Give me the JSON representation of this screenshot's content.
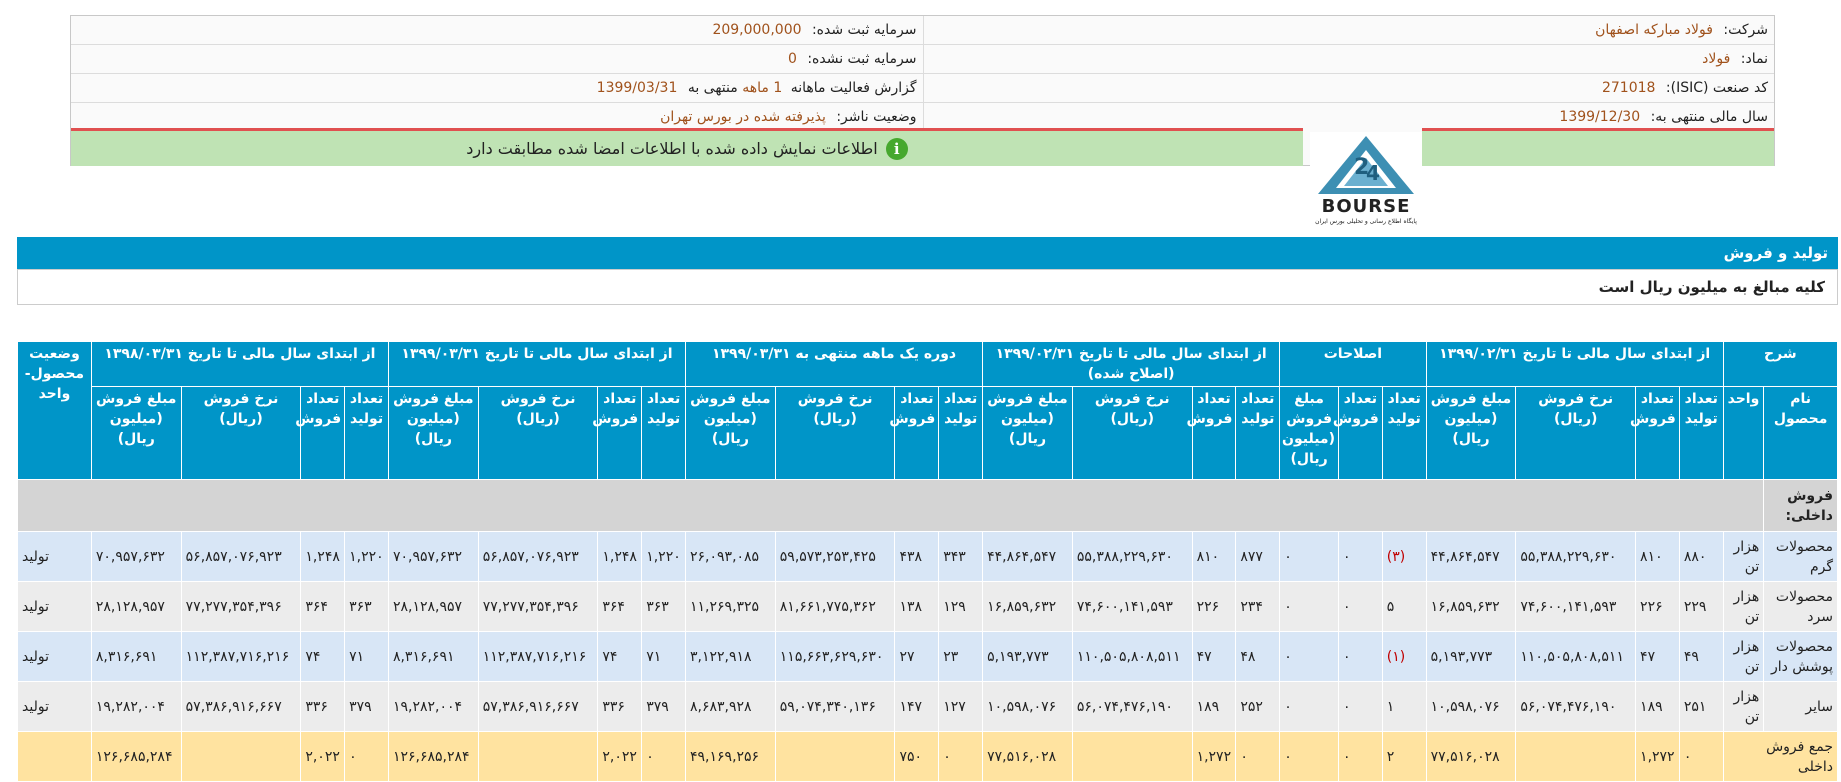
{
  "info": {
    "company_label": "شرکت:",
    "company_value": "فولاد مبارکه اصفهان",
    "reg_capital_label": "سرمایه ثبت شده:",
    "reg_capital_value": "209,000,000",
    "symbol_label": "نماد:",
    "symbol_value": "فولاد",
    "unreg_capital_label": "سرمایه ثبت نشده:",
    "unreg_capital_value": "0",
    "isic_label": "کد صنعت (ISIC):",
    "isic_value": "271018",
    "report_label_pre": "گزارش فعالیت ماهانه",
    "report_months": "1 ماهه",
    "report_label_post": "منتهی به",
    "report_date": "1399/03/31",
    "fiscal_label": "سال مالی منتهی به:",
    "fiscal_value": "1399/12/30",
    "status_label": "وضعیت ناشر:",
    "status_value": "پذیرفته شده در بورس تهران"
  },
  "verify_text": "اطلاعات نمایش داده شده با اطلاعات امضا شده مطابقت دارد",
  "logo": {
    "brand": "BOURSE",
    "subtitle": "پایگاه اطلاع رسانی و تحلیلی بورس ایران"
  },
  "section": {
    "title": "تولید و فروش",
    "note": "کلیه مبالغ به میلیون ریال است"
  },
  "table": {
    "group_headers": {
      "desc": "شرح",
      "g1": "از ابتدای سال مالی تا تاریخ ۱۳۹۹/۰۲/۳۱",
      "g2": "اصلاحات",
      "g3": "از ابتدای سال مالی تا تاریخ ۱۳۹۹/۰۲/۳۱ (اصلاح شده)",
      "g4": "دوره یک ماهه منتهی به ۱۳۹۹/۰۳/۳۱",
      "g5": "از ابتدای سال مالی تا تاریخ ۱۳۹۹/۰۳/۳۱",
      "g6": "از ابتدای سال مالی تا تاریخ ۱۳۹۸/۰۳/۳۱",
      "status": "وضعیت محصول- واحد"
    },
    "sub_headers": {
      "name": "نام محصول",
      "unit": "واحد",
      "prod_qty": "تعداد تولید",
      "sales_qty": "تعداد فروش",
      "rate": "نرخ فروش (ریال)",
      "amount": "مبلغ فروش (میلیون ریال)"
    },
    "section_row": "فروش داخلی:",
    "rows": [
      {
        "name": "محصولات گرم",
        "unit": "هزار تن",
        "c": [
          "۸۸۰",
          "۸۱۰",
          "۵۵,۳۸۸,۲۲۹,۶۳۰",
          "۴۴,۸۶۴,۵۴۷",
          "(۳)",
          "۰",
          "۰",
          "۸۷۷",
          "۸۱۰",
          "۵۵,۳۸۸,۲۲۹,۶۳۰",
          "۴۴,۸۶۴,۵۴۷",
          "۳۴۳",
          "۴۳۸",
          "۵۹,۵۷۳,۲۵۳,۴۲۵",
          "۲۶,۰۹۳,۰۸۵",
          "۱,۲۲۰",
          "۱,۲۴۸",
          "۵۶,۸۵۷,۰۷۶,۹۲۳",
          "۷۰,۹۵۷,۶۳۲",
          "۱,۲۲۰",
          "۱,۲۴۸",
          "۵۶,۸۵۷,۰۷۶,۹۲۳",
          "۷۰,۹۵۷,۶۳۲"
        ],
        "status": "تولید"
      },
      {
        "name": "محصولات سرد",
        "unit": "هزار تن",
        "c": [
          "۲۲۹",
          "۲۲۶",
          "۷۴,۶۰۰,۱۴۱,۵۹۳",
          "۱۶,۸۵۹,۶۳۲",
          "۵",
          "۰",
          "۰",
          "۲۳۴",
          "۲۲۶",
          "۷۴,۶۰۰,۱۴۱,۵۹۳",
          "۱۶,۸۵۹,۶۳۲",
          "۱۲۹",
          "۱۳۸",
          "۸۱,۶۶۱,۷۷۵,۳۶۲",
          "۱۱,۲۶۹,۳۲۵",
          "۳۶۳",
          "۳۶۴",
          "۷۷,۲۷۷,۳۵۴,۳۹۶",
          "۲۸,۱۲۸,۹۵۷",
          "۳۶۳",
          "۳۶۴",
          "۷۷,۲۷۷,۳۵۴,۳۹۶",
          "۲۸,۱۲۸,۹۵۷"
        ],
        "status": "تولید"
      },
      {
        "name": "محصولات پوشش دار",
        "unit": "هزار تن",
        "c": [
          "۴۹",
          "۴۷",
          "۱۱۰,۵۰۵,۸۰۸,۵۱۱",
          "۵,۱۹۳,۷۷۳",
          "(۱)",
          "۰",
          "۰",
          "۴۸",
          "۴۷",
          "۱۱۰,۵۰۵,۸۰۸,۵۱۱",
          "۵,۱۹۳,۷۷۳",
          "۲۳",
          "۲۷",
          "۱۱۵,۶۶۳,۶۲۹,۶۳۰",
          "۳,۱۲۲,۹۱۸",
          "۷۱",
          "۷۴",
          "۱۱۲,۳۸۷,۷۱۶,۲۱۶",
          "۸,۳۱۶,۶۹۱",
          "۷۱",
          "۷۴",
          "۱۱۲,۳۸۷,۷۱۶,۲۱۶",
          "۸,۳۱۶,۶۹۱"
        ],
        "status": "تولید"
      },
      {
        "name": "سایر",
        "unit": "هزار تن",
        "c": [
          "۲۵۱",
          "۱۸۹",
          "۵۶,۰۷۴,۴۷۶,۱۹۰",
          "۱۰,۵۹۸,۰۷۶",
          "۱",
          "۰",
          "۰",
          "۲۵۲",
          "۱۸۹",
          "۵۶,۰۷۴,۴۷۶,۱۹۰",
          "۱۰,۵۹۸,۰۷۶",
          "۱۲۷",
          "۱۴۷",
          "۵۹,۰۷۴,۳۴۰,۱۳۶",
          "۸,۶۸۳,۹۲۸",
          "۳۷۹",
          "۳۳۶",
          "۵۷,۳۸۶,۹۱۶,۶۶۷",
          "۱۹,۲۸۲,۰۰۴",
          "۳۷۹",
          "۳۳۶",
          "۵۷,۳۸۶,۹۱۶,۶۶۷",
          "۱۹,۲۸۲,۰۰۴"
        ],
        "status": "تولید"
      }
    ],
    "total": {
      "name": "جمع فروش داخلی",
      "c": [
        "۰",
        "۱,۲۷۲",
        "",
        "۷۷,۵۱۶,۰۲۸",
        "۲",
        "۰",
        "۰",
        "۰",
        "۱,۲۷۲",
        "",
        "۷۷,۵۱۶,۰۲۸",
        "۰",
        "۷۵۰",
        "",
        "۴۹,۱۶۹,۲۵۶",
        "۰",
        "۲,۰۲۲",
        "",
        "۱۲۶,۶۸۵,۲۸۴",
        "۰",
        "۲,۰۲۲",
        "",
        "۱۲۶,۶۸۵,۲۸۴"
      ]
    }
  }
}
